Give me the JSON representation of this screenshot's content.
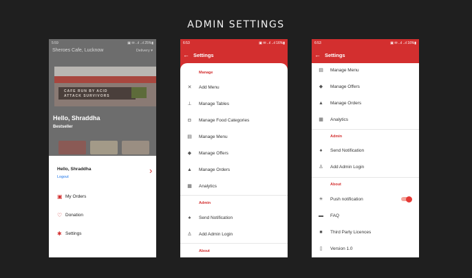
{
  "page_title": "ADMIN SETTINGS",
  "phone1": {
    "status_time": "5:59",
    "status_icons": "▣ ✉ ..ıl ..ıl 25%▮",
    "cafe_title": "Sheroes Cafe, Lucknow",
    "delivery": "Delivery",
    "banner_text_1": "CAFE RUN BY ACID",
    "banner_text_2": "ATTACK SURVIVORS",
    "greeting": "Hello, Shraddha",
    "bestseller": "Bestseller",
    "sheet": {
      "greeting": "Hello, Shraddha",
      "logout": "Logout",
      "menu": [
        {
          "icon": "receipt-icon",
          "label": "My Orders"
        },
        {
          "icon": "heart-icon",
          "label": "Donation"
        },
        {
          "icon": "gear-icon",
          "label": "Settings"
        }
      ]
    }
  },
  "phone2": {
    "status_time": "6:53",
    "status_icons": "▣ ✉ ..ıl ..ıl 16%▮",
    "title": "Settings",
    "section_manage": "Manage",
    "manage_items": [
      {
        "icon": "utensils-icon",
        "label": "Add Menu"
      },
      {
        "icon": "table-icon",
        "label": "Manage Tables"
      },
      {
        "icon": "category-icon",
        "label": "Manage Food Categories"
      },
      {
        "icon": "menu-book-icon",
        "label": "Manage Menu"
      },
      {
        "icon": "tag-icon",
        "label": "Manage Offers"
      },
      {
        "icon": "dish-icon",
        "label": "Manage Orders"
      },
      {
        "icon": "analytics-icon",
        "label": "Analytics"
      }
    ],
    "section_admin": "Admin",
    "admin_items": [
      {
        "icon": "bell-icon",
        "label": "Send Notification"
      },
      {
        "icon": "add-user-icon",
        "label": "Add Admin Login"
      }
    ],
    "section_about": "About"
  },
  "phone3": {
    "status_time": "6:53",
    "status_icons": "▣ ✉ ..ıl ..ıl 16%▮",
    "title": "Settings",
    "manage_items": [
      {
        "icon": "menu-book-icon",
        "label": "Manage Menu"
      },
      {
        "icon": "tag-icon",
        "label": "Manage Offers"
      },
      {
        "icon": "dish-icon",
        "label": "Manage Orders"
      },
      {
        "icon": "analytics-icon",
        "label": "Analytics"
      }
    ],
    "section_admin": "Admin",
    "admin_items": [
      {
        "icon": "bell-icon",
        "label": "Send Notification"
      },
      {
        "icon": "add-user-icon",
        "label": "Add Admin Login"
      }
    ],
    "section_about": "About",
    "about_items": [
      {
        "icon": "bug-icon",
        "label": "Push notification",
        "toggle": true
      },
      {
        "icon": "faq-icon",
        "label": "FAQ"
      },
      {
        "icon": "licence-icon",
        "label": "Third Party Licences"
      },
      {
        "icon": "phone-icon",
        "label": "Version 1.0"
      }
    ]
  },
  "colors": {
    "accent": "#d32f2f",
    "background": "#1f1f1f"
  }
}
